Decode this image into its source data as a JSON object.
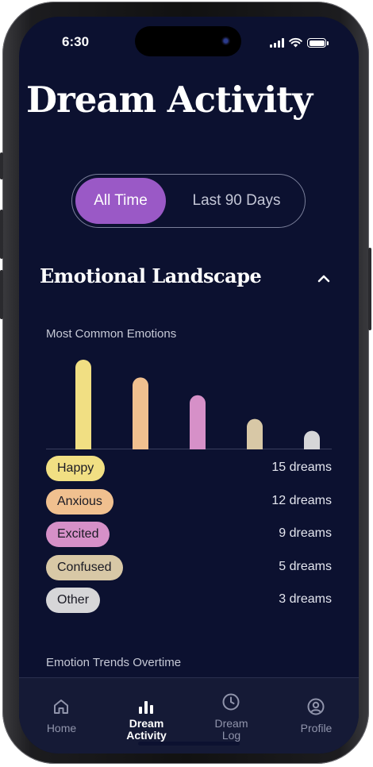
{
  "status_bar": {
    "time": "6:30"
  },
  "page_title": "Dream Activity",
  "segmented": {
    "active": "All Time",
    "inactive": "Last 90 Days"
  },
  "section": {
    "title": "Emotional Landscape"
  },
  "emotions_label": "Most Common Emotions",
  "emotions": [
    {
      "name": "Happy",
      "count": "15 dreams",
      "value": 15,
      "color": "#f1df83"
    },
    {
      "name": "Anxious",
      "count": "12 dreams",
      "value": 12,
      "color": "#f0c08f"
    },
    {
      "name": "Excited",
      "count": "9 dreams",
      "value": 9,
      "color": "#d690c8"
    },
    {
      "name": "Confused",
      "count": "5 dreams",
      "value": 5,
      "color": "#d8c8a6"
    },
    {
      "name": "Other",
      "count": "3 dreams",
      "value": 3,
      "color": "#d6d6d8"
    }
  ],
  "trends_label": "Emotion Trends Overtime",
  "tabs": [
    {
      "label": "Home",
      "icon": "home-icon"
    },
    {
      "label": "Dream\nActivity",
      "icon": "bar-chart-icon",
      "active": true
    },
    {
      "label": "Dream\nLog",
      "icon": "clock-icon"
    },
    {
      "label": "Profile",
      "icon": "profile-icon"
    }
  ],
  "colors": {
    "background": "#0c1130",
    "accent": "#9a59c6",
    "tabbar": "#151a36"
  },
  "chart_data": {
    "type": "bar",
    "categories": [
      "Happy",
      "Anxious",
      "Excited",
      "Confused",
      "Other"
    ],
    "values": [
      15,
      12,
      9,
      5,
      3
    ],
    "title": "Most Common Emotions",
    "ylim": [
      0,
      15
    ]
  }
}
